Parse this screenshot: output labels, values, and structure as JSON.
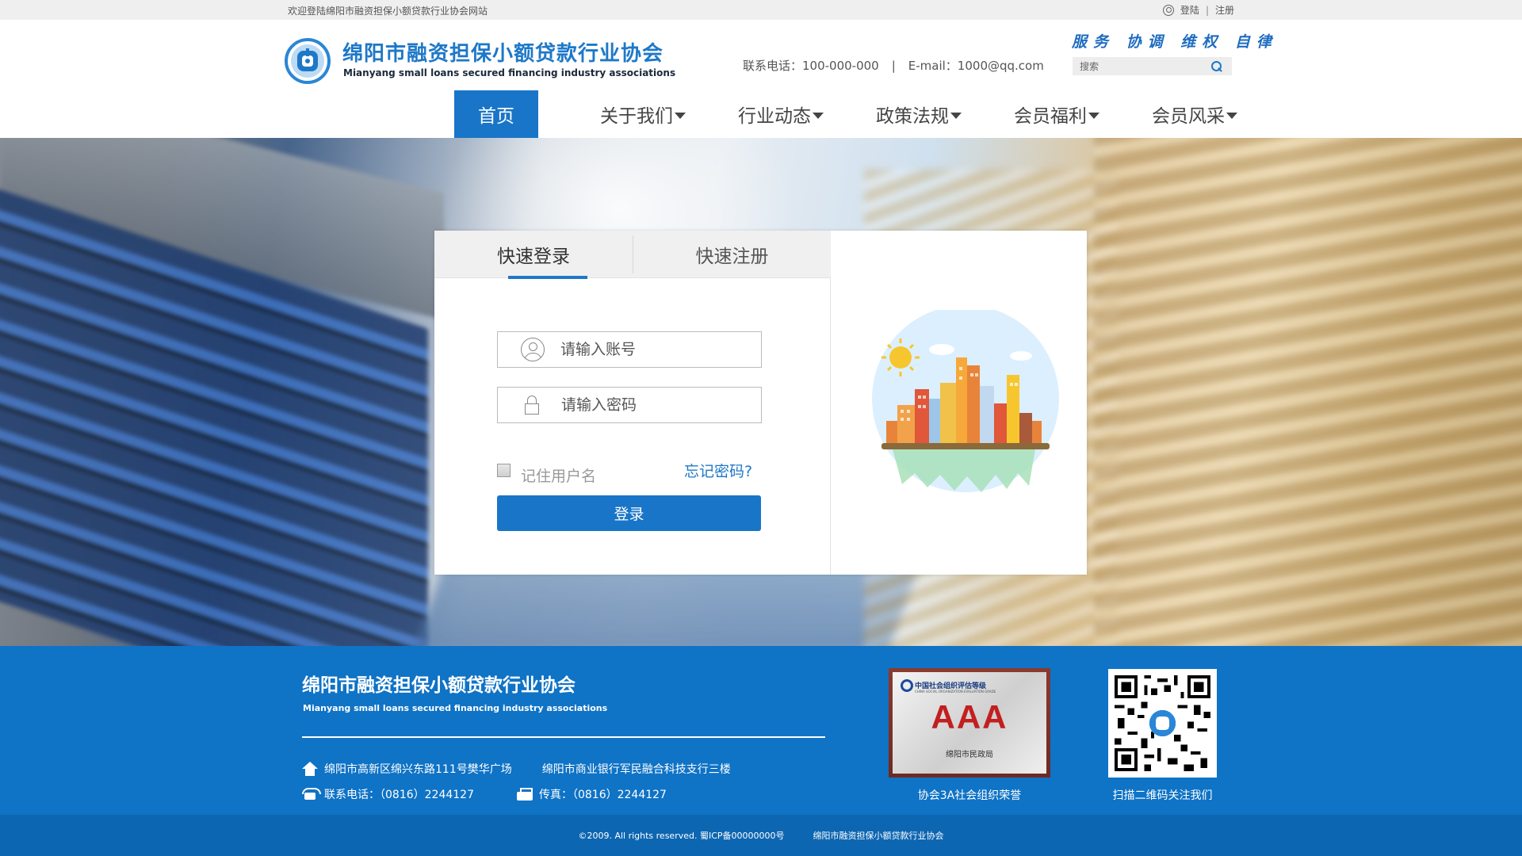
{
  "topbar": {
    "welcome": "欢迎登陆绵阳市融资担保小额贷款行业协会网站",
    "login": "登陆",
    "separator": "|",
    "register": "注册"
  },
  "header": {
    "brand_cn": "绵阳市融资担保小额贷款行业协会",
    "brand_en": "Mianyang small loans secured financing industry associations",
    "slogan": "服务 协调 维权 自律",
    "phone_label": "联系电话：100-000-000",
    "pipe": "|",
    "email_label": "E-mail：1000@qq.com",
    "search_placeholder": "搜索"
  },
  "nav": {
    "items": [
      {
        "label": "首页",
        "active": true
      },
      {
        "label": "关于我们"
      },
      {
        "label": "行业动态"
      },
      {
        "label": "政策法规"
      },
      {
        "label": "会员福利"
      },
      {
        "label": "会员风采"
      }
    ]
  },
  "login": {
    "tabs": [
      {
        "label": "快速登录",
        "active": true
      },
      {
        "label": "快速注册"
      }
    ],
    "account_placeholder": "请输入账号",
    "password_placeholder": "请输入密码",
    "remember_label": "记住用户名",
    "remember_checked": false,
    "forgot_label": "忘记密码?",
    "submit_label": "登录"
  },
  "footer": {
    "brand_cn": "绵阳市融资担保小额贷款行业协会",
    "brand_en": "Mianyang small loans secured financing industry associations",
    "address1": "绵阳市高新区绵兴东路111号樊华广场",
    "address2": "绵阳市商业银行军民融合科技支行三楼",
    "phone": "联系电话：（0816）2244127",
    "fax": "传真：（0816）2244127",
    "cert": {
      "title": "中国社会组织评估等级",
      "subtitle": "CHINA SOCIAL ORGANIZATION EVALUATION GRADE",
      "grade": "AAA",
      "issuer": "绵阳市民政局"
    },
    "cert_caption": "协会3A社会组织荣誉",
    "qr_caption": "扫描二维码关注我们",
    "copyright": "©2009. All rights reserved. 蜀ICP备00000000号",
    "copyright_org": "绵阳市融资担保小额贷款行业协会"
  },
  "colors": {
    "primary": "#1975c8",
    "footer_bg": "#0f73c6",
    "copyright_bg": "#0d66b1",
    "topbar_bg": "#efefef",
    "cert_red": "#c21f1f"
  },
  "icons": {
    "top_login": "user-circle-icon",
    "search": "search-icon",
    "nav_caret": "caret-down-icon",
    "account": "user-icon",
    "password": "lock-icon",
    "address": "home-icon",
    "phone": "telephone-icon",
    "fax": "fax-icon"
  }
}
